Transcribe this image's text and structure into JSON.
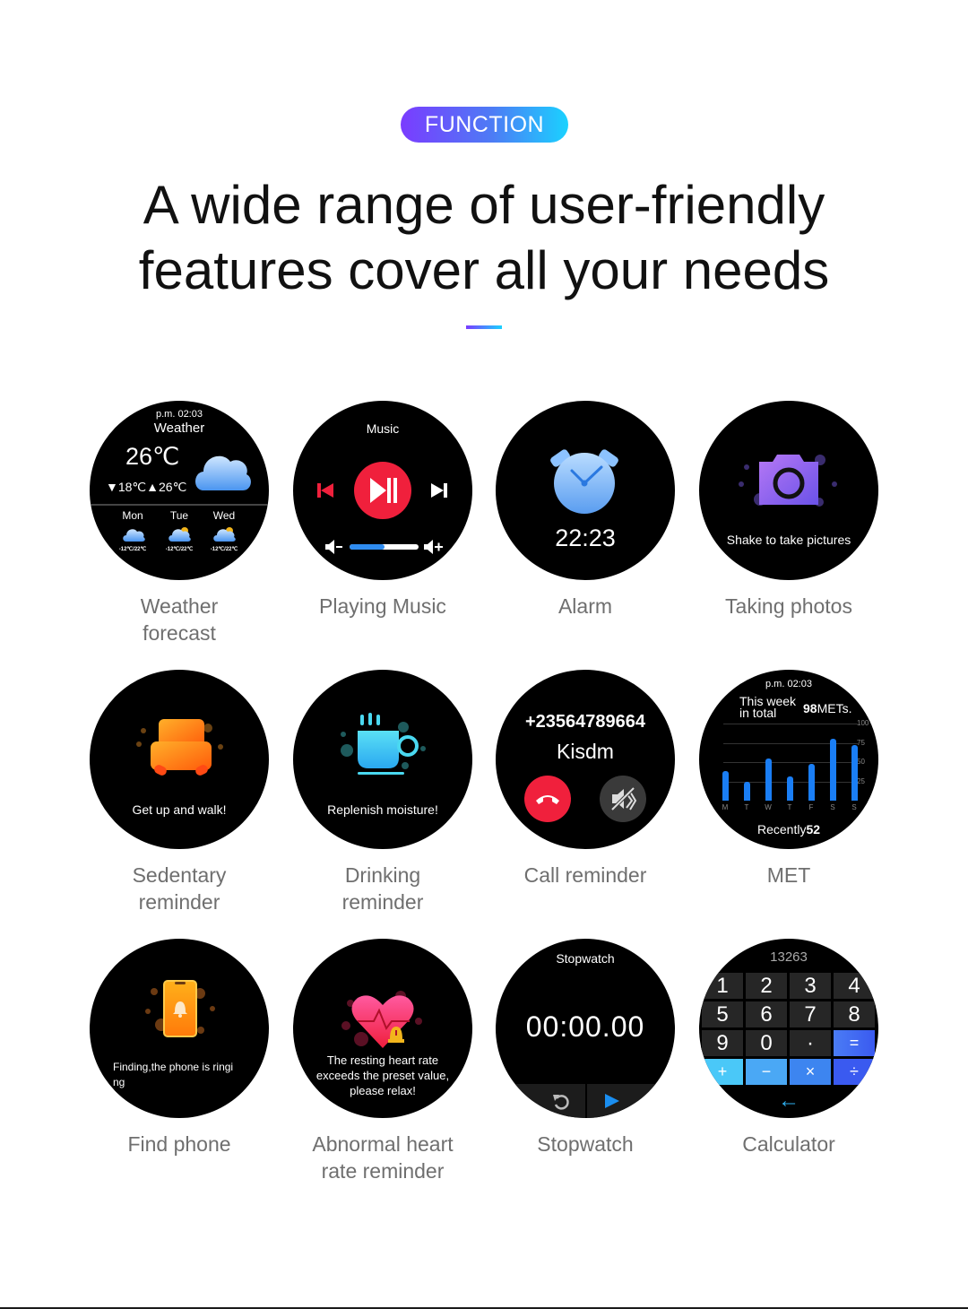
{
  "header": {
    "badge": "FUNCTION",
    "headline_line1": "A wide range of user-friendly",
    "headline_line2": "features cover all your needs"
  },
  "colors": {
    "badge_gradient_start": "#7a3cff",
    "badge_gradient_end": "#1ad2ff",
    "caption": "#6f6f6f",
    "watch_bg": "#000000",
    "accent_red": "#f0203c",
    "accent_blue": "#2f8cf0"
  },
  "features": [
    {
      "caption_line1": "Weather",
      "caption_line2": "forecast",
      "icon": "weather-cloud-icon",
      "screen": {
        "time": "p.m. 02:03",
        "title": "Weather",
        "temp": "26℃",
        "range": "▼18℃▲26℃",
        "days": [
          {
            "day": "Mon",
            "range": "-12℃/22℃"
          },
          {
            "day": "Tue",
            "range": "-12℃/22℃"
          },
          {
            "day": "Wed",
            "range": "-12℃/22℃"
          }
        ]
      }
    },
    {
      "caption_line1": "Playing Music",
      "caption_line2": "",
      "icon": "music-play-pause-icon",
      "screen": {
        "title": "Music",
        "volume_fraction": 0.5
      }
    },
    {
      "caption_line1": "Alarm",
      "caption_line2": "",
      "icon": "alarm-clock-icon",
      "screen": {
        "time": "22:23"
      }
    },
    {
      "caption_line1": "Taking photos",
      "caption_line2": "",
      "icon": "camera-icon",
      "screen": {
        "text": "Shake to take pictures"
      }
    },
    {
      "caption_line1": "Sedentary",
      "caption_line2": "reminder",
      "icon": "armchair-icon",
      "screen": {
        "text": "Get up and walk!"
      }
    },
    {
      "caption_line1": "Drinking",
      "caption_line2": "reminder",
      "icon": "coffee-cup-icon",
      "screen": {
        "text": "Replenish moisture!"
      }
    },
    {
      "caption_line1": "Call reminder",
      "caption_line2": "",
      "icon": "phone-hangup-icon",
      "screen": {
        "number": "+23564789664",
        "name": "Kisdm"
      }
    },
    {
      "caption_line1": "MET",
      "caption_line2": "",
      "icon": "bar-chart-icon",
      "screen": {
        "time": "p.m. 02:03",
        "head_line1": "This week",
        "head_line2": "in total",
        "total_value": "98",
        "total_unit": "METs.",
        "recent_label": "Recently",
        "recent_value": "52",
        "ticks": [
          "100",
          "75",
          "50",
          "25"
        ],
        "days": [
          "M",
          "T",
          "W",
          "T",
          "F",
          "S",
          "S"
        ],
        "values": [
          38,
          24,
          55,
          31,
          48,
          80,
          72
        ],
        "ymax": 100
      }
    },
    {
      "caption_line1": "Find phone",
      "caption_line2": "",
      "icon": "phone-bell-icon",
      "screen": {
        "text_line1": "Finding,the phone is ringi",
        "text_line2": "ng"
      }
    },
    {
      "caption_line1": "Abnormal heart",
      "caption_line2": "rate reminder",
      "icon": "heart-alert-icon",
      "screen": {
        "text_line1": "The resting heart rate",
        "text_line2": "exceeds the preset value,",
        "text_line3": "please relax!"
      }
    },
    {
      "caption_line1": "Stopwatch",
      "caption_line2": "",
      "icon": "stopwatch-icon",
      "screen": {
        "title": "Stopwatch",
        "time": "00:00.00"
      }
    },
    {
      "caption_line1": "Calculator",
      "caption_line2": "",
      "icon": "calculator-icon",
      "screen": {
        "display": "13263",
        "keys": [
          "1",
          "2",
          "3",
          "4",
          "5",
          "6",
          "7",
          "8",
          "9",
          "0",
          "·",
          "=",
          "+",
          "−",
          "×",
          "÷"
        ],
        "back": "←"
      }
    }
  ]
}
